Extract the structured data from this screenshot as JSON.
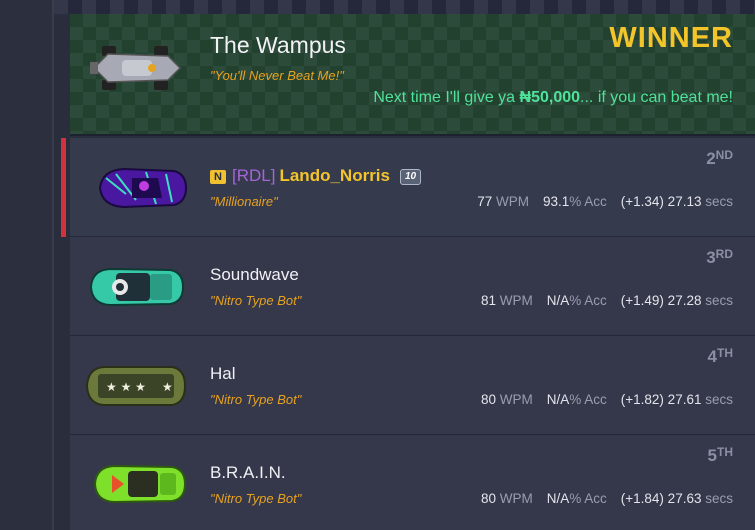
{
  "winner": {
    "name": "The Wampus",
    "title": "\"You'll Never Beat Me!\"",
    "label": "WINNER",
    "msg_prefix": "Next time I'll give ya",
    "currency_symbol": "₦",
    "amount": "50,000",
    "msg_suffix": "... if you can beat me!"
  },
  "racers": [
    {
      "place": "2",
      "place_suffix": "ND",
      "tag_icon": "N",
      "team": "[RDL]",
      "name": "Lando_Norris",
      "level": "10",
      "title": "\"Millionaire\"",
      "wpm": "77",
      "wpm_unit": "WPM",
      "acc": "93.1",
      "acc_unit": "% Acc",
      "time": "(+1.34) 27.13",
      "time_unit": "secs",
      "car_color": "#5a1fb4"
    },
    {
      "place": "3",
      "place_suffix": "RD",
      "name": "Soundwave",
      "title": "\"Nitro Type Bot\"",
      "wpm": "81",
      "wpm_unit": "WPM",
      "acc": "N/A",
      "acc_unit": "% Acc",
      "time": "(+1.49) 27.28",
      "time_unit": "secs",
      "car_color": "#35c9a8"
    },
    {
      "place": "4",
      "place_suffix": "TH",
      "name": "Hal",
      "title": "\"Nitro Type Bot\"",
      "wpm": "80",
      "wpm_unit": "WPM",
      "acc": "N/A",
      "acc_unit": "% Acc",
      "time": "(+1.82) 27.61",
      "time_unit": "secs",
      "car_color": "#6b7a3a"
    },
    {
      "place": "5",
      "place_suffix": "TH",
      "name": "B.R.A.I.N.",
      "title": "\"Nitro Type Bot\"",
      "wpm": "80",
      "wpm_unit": "WPM",
      "acc": "N/A",
      "acc_unit": "% Acc",
      "time": "(+1.84) 27.63",
      "time_unit": "secs",
      "car_color": "#7ee02a"
    }
  ],
  "colors": {
    "winner_gold": "#f3c52b",
    "winner_msg": "#4fe29a",
    "title_orange": "#e7a21f",
    "team_purple": "#a565d8",
    "me_marker": "#d3323d"
  }
}
